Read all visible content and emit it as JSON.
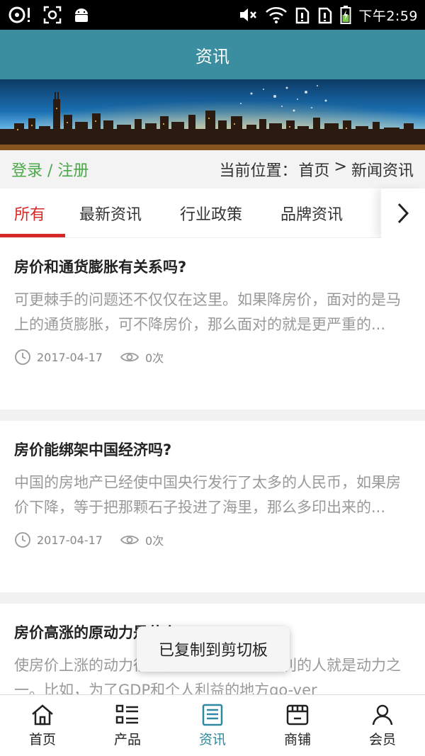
{
  "status_bar": {
    "time": "下午2:59",
    "icons_left": [
      "disc-alert-icon",
      "screenshot-icon",
      "android-icon"
    ],
    "icons_right": [
      "mute-icon",
      "wifi-icon",
      "sim1-icon",
      "sim2-icon",
      "battery-charging-icon"
    ]
  },
  "header": {
    "title": "资讯"
  },
  "breadcrumb": {
    "login": "登录 / 注册",
    "label": "当前位置：",
    "home": "首页",
    "separator": ">",
    "current": "新闻资讯"
  },
  "tabs": [
    {
      "label": "所有",
      "active": true
    },
    {
      "label": "最新资讯",
      "active": false
    },
    {
      "label": "行业政策",
      "active": false
    },
    {
      "label": "品牌资讯",
      "active": false
    }
  ],
  "articles": [
    {
      "title": "房价和通货膨胀有关系吗?",
      "summary": "可更棘手的问题还不仅仅在这里。如果降房价，面对的是马上的通货膨胀，可不降房价，那么面对的就是更严重的...",
      "date": "2017-04-17",
      "views": "0次"
    },
    {
      "title": "房价能绑架中国经济吗?",
      "summary": "中国的房地产已经使中国央行发行了太多的人民币，如果房价下降，等于把那颗石子投进了海里，那么多印出来的...",
      "date": "2017-04-17",
      "views": "0次"
    },
    {
      "title": "房价高涨的原动力是什么?",
      "summary": "使房价上涨的动力很多，房价上涨对其有利的人就是动力之一。比如，为了GDP和个人利益的地方go-ver",
      "date": "",
      "views": ""
    }
  ],
  "toast": {
    "text": "已复制到剪切板"
  },
  "bottom_nav": [
    {
      "label": "首页",
      "icon": "home-icon",
      "active": false
    },
    {
      "label": "产品",
      "icon": "product-list-icon",
      "active": false
    },
    {
      "label": "资讯",
      "icon": "news-icon",
      "active": true
    },
    {
      "label": "商铺",
      "icon": "shop-icon",
      "active": false
    },
    {
      "label": "会员",
      "icon": "user-icon",
      "active": false
    }
  ],
  "colors": {
    "header": "#3a8ea0",
    "accent_red": "#d62828",
    "login_green": "#4aa84a",
    "nav_active": "#2e8aa0"
  }
}
